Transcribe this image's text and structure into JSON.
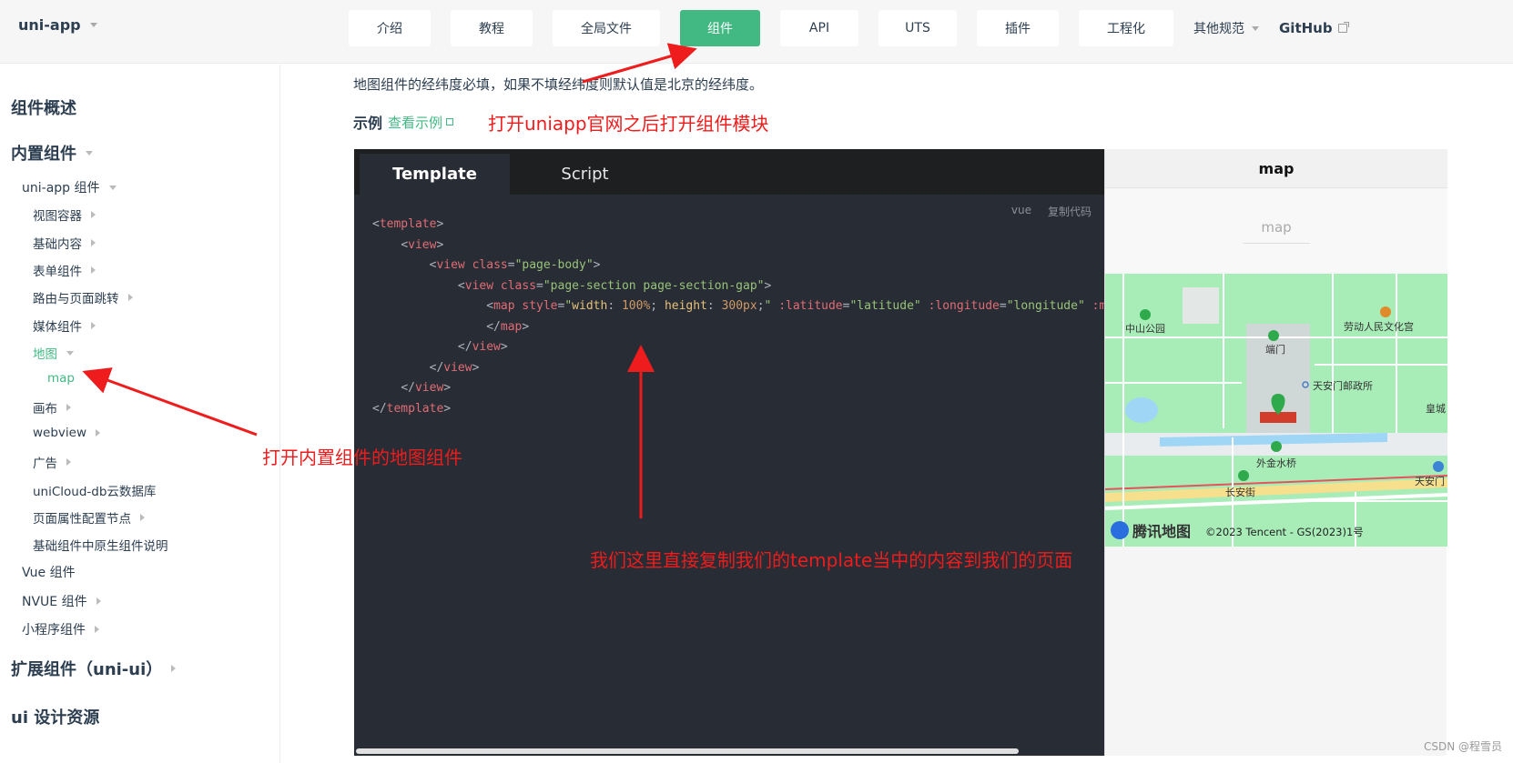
{
  "header": {
    "brand": "uni-app",
    "nav": [
      "介绍",
      "教程",
      "全局文件",
      "组件",
      "API",
      "UTS",
      "插件",
      "工程化"
    ],
    "more": "其他规范",
    "github": "GitHub",
    "accent_color": "#42b983"
  },
  "sidebar": {
    "overview": "组件概述",
    "builtin": "内置组件",
    "uniapp_components": "uni-app 组件",
    "items": [
      "视图容器",
      "基础内容",
      "表单组件",
      "路由与页面跳转",
      "媒体组件"
    ],
    "map_group": "地图",
    "map_item": "map",
    "items_after": [
      "画布",
      "webview",
      "广告"
    ],
    "items_plain": [
      "uniCloud-db云数据库",
      "页面属性配置节点",
      "基础组件中原生组件说明"
    ],
    "vue": "Vue 组件",
    "nvue": "NVUE 组件",
    "mini": "小程序组件",
    "ext": "扩展组件（uni-ui）",
    "design": "ui 设计资源"
  },
  "content": {
    "intro": "地图组件的经纬度必填，如果不填经纬度则默认值是北京的经纬度。",
    "example_label": "示例",
    "example_link": "查看示例"
  },
  "annotations": {
    "top": "打开uniapp官网之后打开组件模块",
    "left": "打开内置组件的地图组件",
    "code": "我们这里直接复制我们的template当中的内容到我们的页面",
    "color": "#ee1c1c"
  },
  "code_panel": {
    "tabs": [
      "Template",
      "Script"
    ],
    "lang": "vue",
    "copy": "复制代码"
  },
  "preview": {
    "title": "map",
    "subtitle": "map",
    "map_logo": "腾讯地图",
    "map_copyright": "©2023 Tencent - GS(2023)1号",
    "map_labels": [
      "中山公园",
      "劳动人民文化宫",
      "端门",
      "天安门邮政所",
      "皇城",
      "外金水桥",
      "长安街",
      "天安门"
    ]
  },
  "watermark": "CSDN @程雪员"
}
